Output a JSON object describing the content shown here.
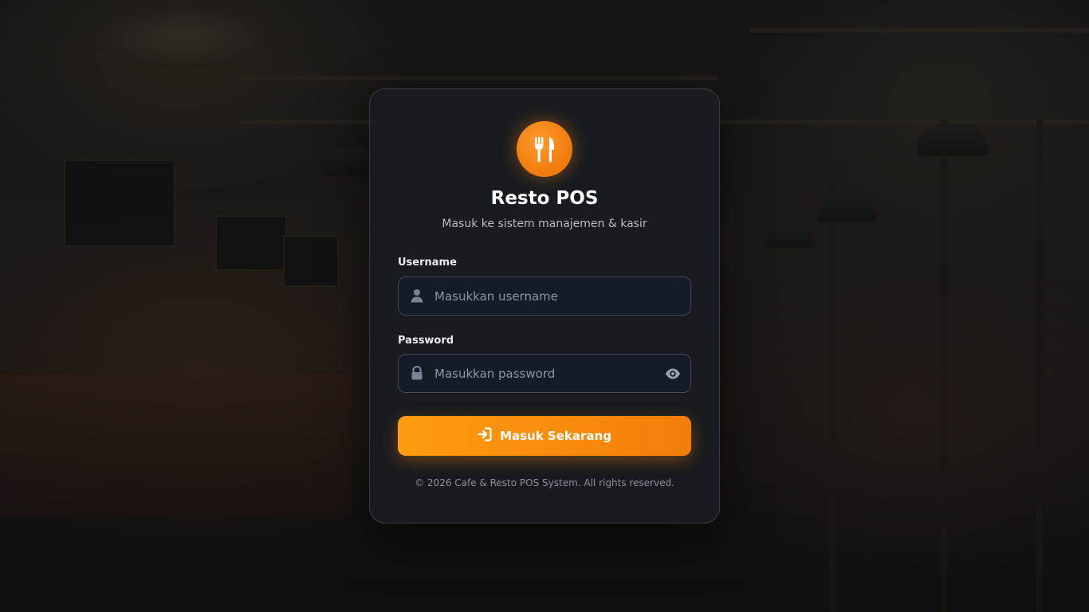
{
  "app": {
    "title": "Resto POS",
    "subtitle": "Masuk ke sistem manajemen & kasir"
  },
  "form": {
    "username_label": "Username",
    "username_placeholder": "Masukkan username",
    "username_value": "",
    "password_label": "Password",
    "password_placeholder": "Masukkan password",
    "password_value": "",
    "submit_label": "Masuk Sekarang"
  },
  "footer": {
    "copyright": "© 2026 Cafe & Resto POS System. All rights reserved."
  },
  "icons": {
    "logo": "utensils-icon",
    "username": "user-icon",
    "password": "lock-icon",
    "toggle_password": "eye-icon",
    "submit": "sign-in-icon"
  },
  "colors": {
    "accent": "#f7890c",
    "card_bg": "#181c21",
    "input_bg": "#161b28"
  }
}
